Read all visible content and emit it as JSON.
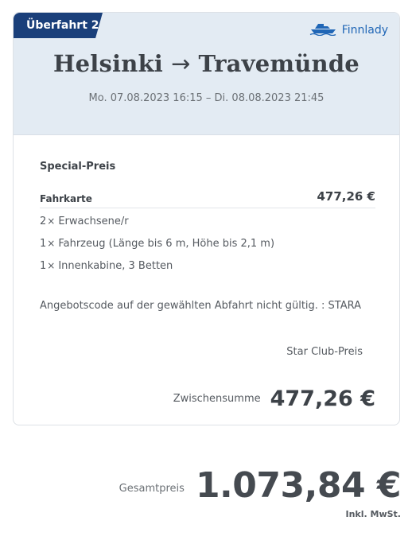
{
  "leg": {
    "badge": "Überfahrt 2",
    "ship_name": "Finnlady",
    "ship_icon": "ship-icon"
  },
  "route": {
    "from": "Helsinki",
    "arrow": "→",
    "to": "Travemünde"
  },
  "dates": "Mo. 07.08.2023 16:15 – Di. 08.08.2023 21:45",
  "fare": {
    "title": "Special-Preis",
    "ticket_label": "Fahrkarte",
    "ticket_amount": "477,26 €",
    "items": [
      {
        "qty": "2",
        "times": "×",
        "text": "Erwachsene/r"
      },
      {
        "qty": "1",
        "times": "×",
        "text": "Fahrzeug (Länge bis 6 m, Höhe bis 2,1 m)"
      },
      {
        "qty": "1",
        "times": "×",
        "text": "Innenkabine, 3 Betten"
      }
    ],
    "offer_note": "Angebotscode auf der gewählten Abfahrt nicht gültig. : STARA",
    "star_club": "Star Club-Preis",
    "subtotal_label": "Zwischensumme",
    "subtotal_value": "477,26 €"
  },
  "total": {
    "label": "Gesamtpreis",
    "value": "1.073,84 €",
    "vat": "Inkl. MwSt."
  },
  "colors": {
    "badge": "#1a3f7a",
    "header_bg": "#e3ebf3",
    "accent": "#2066b6",
    "text": "#3d4248"
  }
}
